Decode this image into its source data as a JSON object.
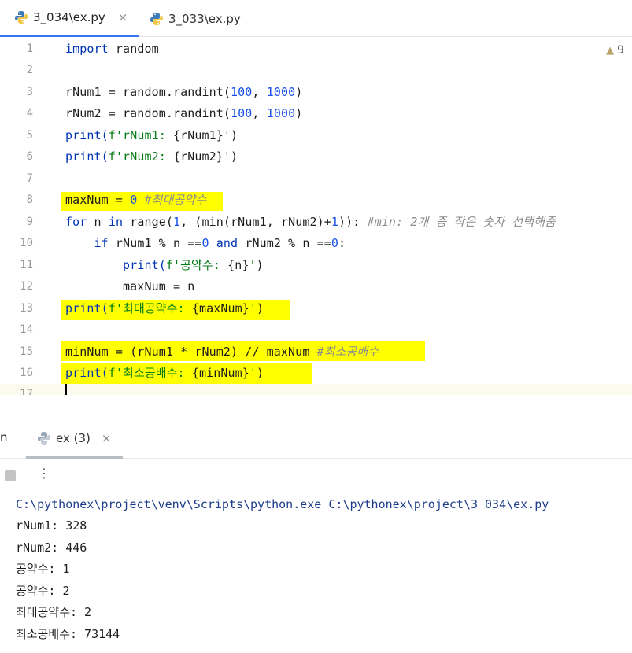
{
  "editor_tabs": [
    {
      "label": "3_034\\ex.py",
      "active": true
    },
    {
      "label": "3_033\\ex.py",
      "active": false
    }
  ],
  "close_glyph": "×",
  "inspection": {
    "warning_count": "9"
  },
  "gutter": [
    "1",
    "2",
    "3",
    "4",
    "5",
    "6",
    "7",
    "8",
    "9",
    "10",
    "11",
    "12",
    "13",
    "14",
    "15",
    "16",
    "17"
  ],
  "code": {
    "l1_kw": "import",
    "l1_rest": " random",
    "l3_a": "rNum1 = random.randint(",
    "l3_n1": "100",
    "l3_b": ", ",
    "l3_n2": "1000",
    "l3_c": ")",
    "l4_a": "rNum2 = random.randint(",
    "l4_n1": "100",
    "l4_b": ", ",
    "l4_n2": "1000",
    "l4_c": ")",
    "l5_a": "print(",
    "l5_s1": "f'rNum1: ",
    "l5_m": "{rNum1}",
    "l5_s2": "'",
    "l5_c": ")",
    "l6_a": "print(",
    "l6_s1": "f'rNum2: ",
    "l6_m": "{rNum2}",
    "l6_s2": "'",
    "l6_c": ")",
    "l8_a": "maxNum = ",
    "l8_n": "0",
    "l8_sp": " ",
    "l8_cmt": "#최대공약수",
    "l9_kw1": "for",
    "l9_a": " n ",
    "l9_kw2": "in",
    "l9_b": " range(",
    "l9_n1": "1",
    "l9_c": ", (min(rNum1, rNum2)+",
    "l9_n2": "1",
    "l9_d": ")): ",
    "l9_cmt": "#min: 2개 중 작은 숫자 선택해줌",
    "l10_ind": "    ",
    "l10_kw1": "if",
    "l10_a": " rNum1 % n ==",
    "l10_n1": "0",
    "l10_sp": " ",
    "l10_kw2": "and",
    "l10_b": " rNum2 % n ==",
    "l10_n2": "0",
    "l10_c": ":",
    "l11_ind": "        ",
    "l11_a": "print(",
    "l11_s1": "f'공약수: ",
    "l11_m": "{n}",
    "l11_s2": "'",
    "l11_c": ")",
    "l12_text": "        maxNum = n",
    "l13_a": "print(",
    "l13_s1": "f'최대공약수: ",
    "l13_m": "{maxNum}",
    "l13_s2": "'",
    "l13_c": ")",
    "l15_a": "minNum = (rNum1 * rNum2) // maxNum ",
    "l15_cmt": "#최소공배수",
    "l16_a": "print(",
    "l16_s1": "f'최소공배수: ",
    "l16_m": "{minNum}",
    "l16_s2": "'",
    "l16_c": ")"
  },
  "run_panel": {
    "label": "n",
    "tab_label": "ex (3)",
    "more_glyph": "⋮"
  },
  "console_output": [
    "C:\\pythonex\\project\\venv\\Scripts\\python.exe C:\\pythonex\\project\\3_034\\ex.py",
    "rNum1: 328",
    "rNum2: 446",
    "공약수: 1",
    "공약수: 2",
    "최대공약수: 2",
    "최소공배수: 73144"
  ],
  "colors": {
    "highlight": "#ffff00",
    "keyword": "#0033b3",
    "number": "#1750eb",
    "string": "#067d17",
    "comment": "#8c8c8c",
    "active_tab_underline": "#3574f0"
  }
}
